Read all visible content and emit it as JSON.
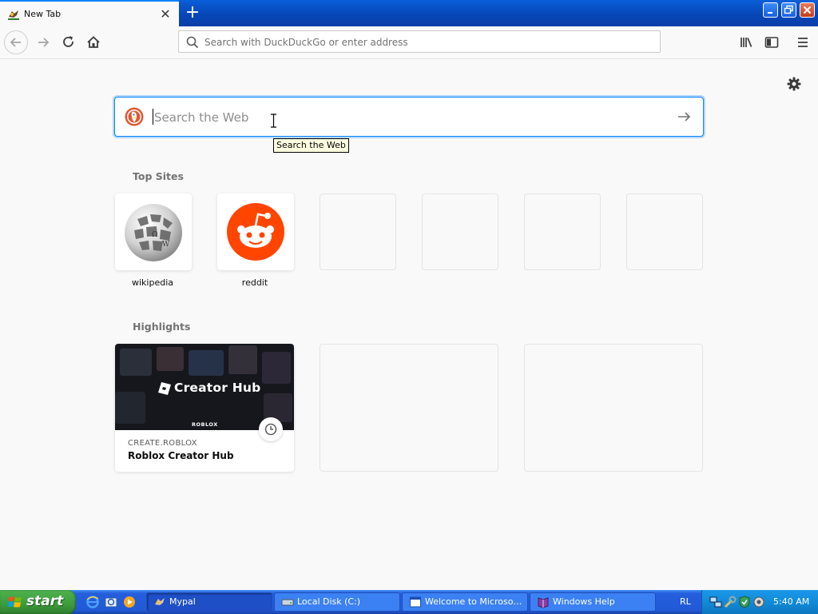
{
  "browser": {
    "tab": {
      "title": "New Tab"
    },
    "urlbar": {
      "placeholder": "Search with DuckDuckGo or enter address"
    }
  },
  "newtab": {
    "search": {
      "placeholder": "Search the Web",
      "tooltip": "Search the Web"
    },
    "top_sites": {
      "heading": "Top Sites",
      "sites": [
        {
          "label": "wikipedia",
          "icon": "wikipedia-globe-icon"
        },
        {
          "label": "reddit",
          "icon": "reddit-alien-icon"
        }
      ],
      "empty_slots": 4
    },
    "highlights": {
      "heading": "Highlights",
      "card": {
        "thumb_title": "Creator Hub",
        "thumb_brand": "ROBLOX",
        "host": "CREATE.ROBLOX",
        "title": "Roblox Creator Hub"
      },
      "empty_slots": 2
    }
  },
  "taskbar": {
    "start_label": "start",
    "buttons": [
      {
        "label": "Mypal",
        "active": true
      },
      {
        "label": "Local Disk (C:)",
        "active": false
      },
      {
        "label": "Welcome to Microsoft...",
        "active": false
      },
      {
        "label": "Windows Help",
        "active": false
      }
    ],
    "language": "RL",
    "clock": "5:40 AM"
  },
  "colors": {
    "accent": "#0a84ff",
    "reddit": "#ff4500",
    "duckduckgo": "#de5833",
    "taskbar": "#245edc",
    "start_green": "#3c9c3c"
  }
}
